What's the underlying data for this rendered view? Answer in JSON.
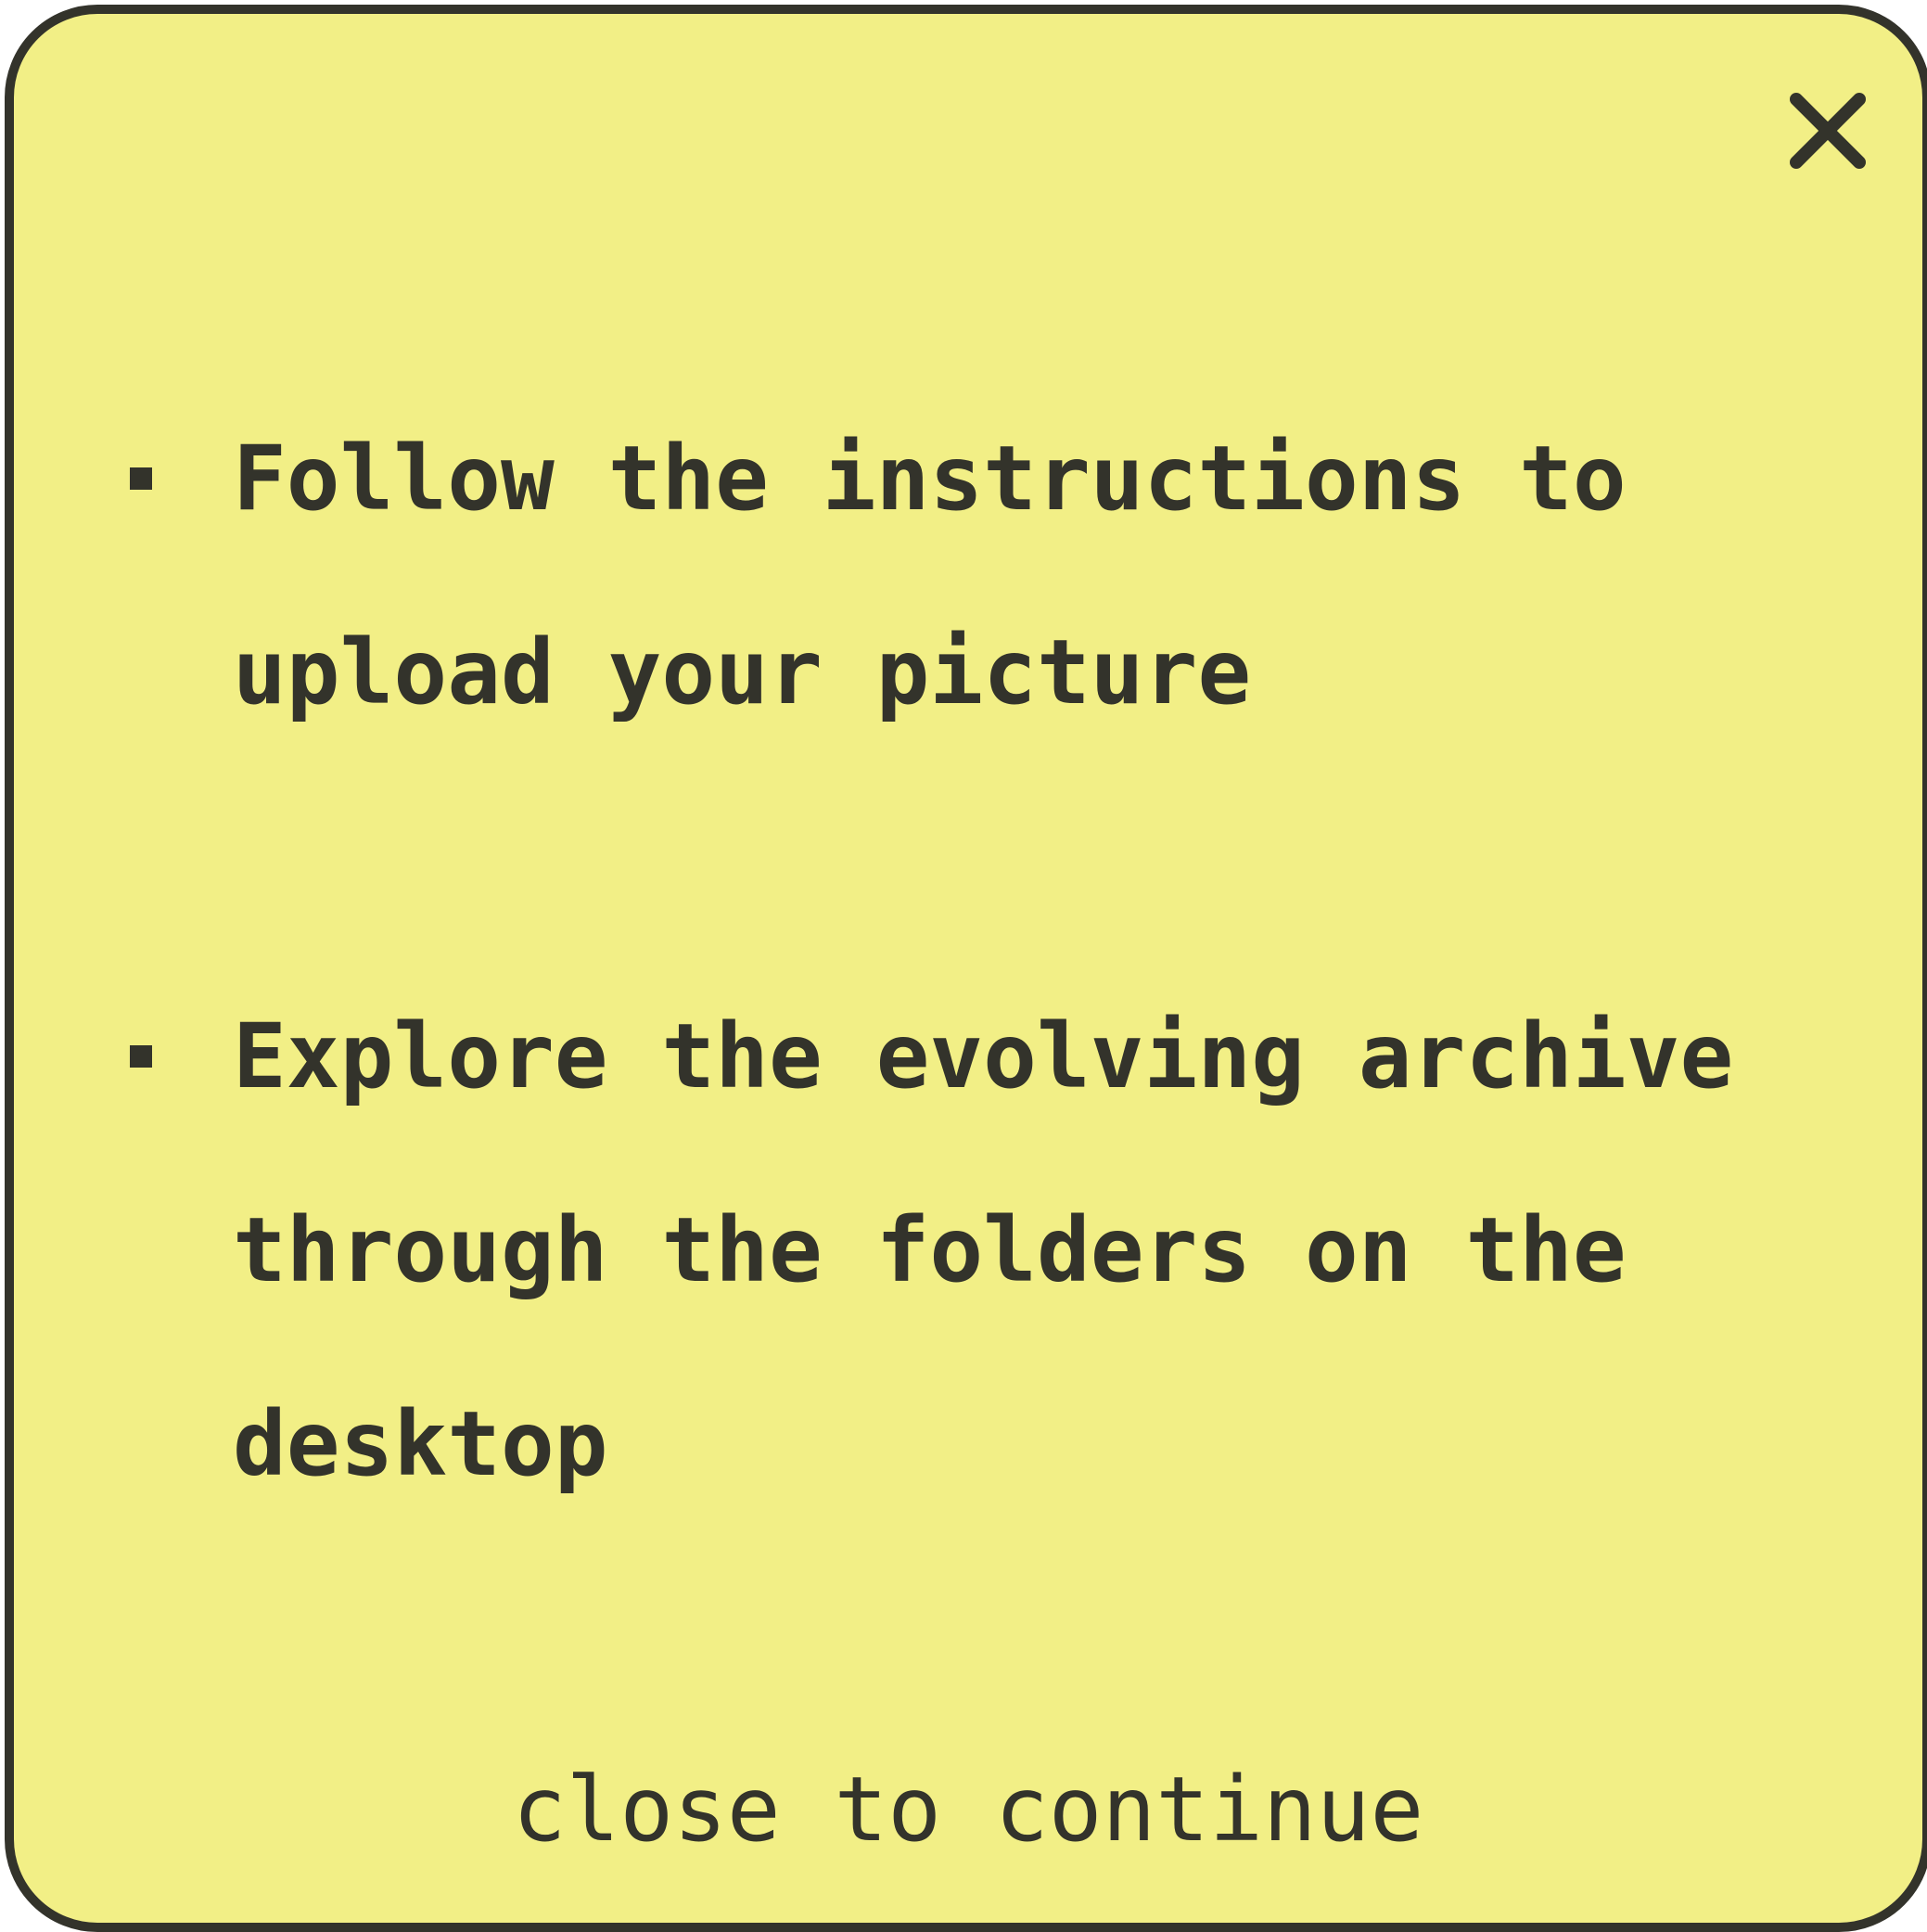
{
  "dialog": {
    "close_icon": "close-x-icon",
    "instructions": [
      {
        "text": "Follow the instructions to upload your picture"
      },
      {
        "text": "Explore the evolving archive through the folders on the desktop"
      }
    ],
    "footer_label": "close to continue"
  },
  "colors": {
    "background": "#f2ef86",
    "foreground": "#33332b",
    "border": "#33332b"
  }
}
